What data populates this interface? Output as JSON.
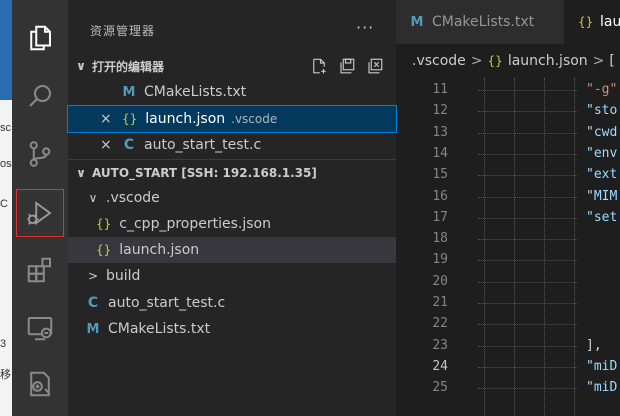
{
  "background_strip": {
    "texts": [
      "sc",
      "os",
      "C",
      "3",
      "移"
    ]
  },
  "explorer": {
    "title": "资源管理器",
    "more": "···",
    "open_editors": {
      "label": "打开的编辑器",
      "items": [
        {
          "icon": "M",
          "name": "CMakeLists.txt",
          "desc": "",
          "close": ""
        },
        {
          "icon": "{}",
          "name": "launch.json",
          "desc": ".vscode",
          "close": "×"
        },
        {
          "icon": "C",
          "name": "auto_start_test.c",
          "desc": "",
          "close": "×"
        }
      ]
    },
    "workspace": {
      "label": "AUTO_START [SSH: 192.168.1.35]",
      "items": [
        {
          "chev": "∨",
          "icon": "",
          "name": ".vscode"
        },
        {
          "chev": "",
          "icon": "{}",
          "name": "c_cpp_properties.json"
        },
        {
          "chev": "",
          "icon": "{}",
          "name": "launch.json"
        },
        {
          "chev": ">",
          "icon": "",
          "name": "build"
        },
        {
          "chev": "",
          "icon": "C",
          "name": "auto_start_test.c"
        },
        {
          "chev": "",
          "icon": "M",
          "name": "CMakeLists.txt"
        }
      ]
    }
  },
  "tabs": [
    {
      "icon": "M",
      "label": "CMakeLists.txt"
    },
    {
      "icon": "{}",
      "label": "lau"
    }
  ],
  "breadcrumb": {
    "folder": ".vscode",
    "sep": ">",
    "icon": "{}",
    "file": "launch.json",
    "sep2": ">",
    "rest": "["
  },
  "code": {
    "lines": [
      {
        "n": "11",
        "text": "\"-g\""
      },
      {
        "n": "12",
        "text": "\"sto"
      },
      {
        "n": "13",
        "text": "\"cwd"
      },
      {
        "n": "14",
        "text": "\"env"
      },
      {
        "n": "15",
        "text": "\"ext"
      },
      {
        "n": "16",
        "text": "\"MIM"
      },
      {
        "n": "17",
        "text": "\"set"
      },
      {
        "n": "18",
        "text": ""
      },
      {
        "n": "19",
        "text": ""
      },
      {
        "n": "20",
        "text": ""
      },
      {
        "n": "21",
        "text": ""
      },
      {
        "n": "22",
        "text": ""
      },
      {
        "n": "23",
        "text": "],"
      },
      {
        "n": "24",
        "text": "\"miD"
      },
      {
        "n": "25",
        "text": "\"miD"
      }
    ],
    "current_line": "24"
  },
  "colors": {
    "activity_bar": "#333333",
    "sidebar": "#252526",
    "editor": "#1e1e1e",
    "selection": "#04395e",
    "highlight_box": "#e03131"
  }
}
